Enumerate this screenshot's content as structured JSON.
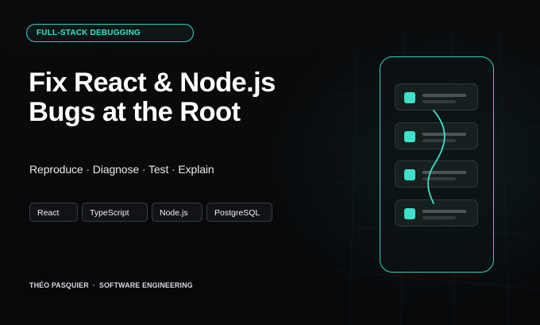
{
  "badge": {
    "label": "FULL-STACK DEBUGGING"
  },
  "headline": {
    "line1": "Fix React & Node.js",
    "line2": "Bugs at the Root"
  },
  "tagline": "Reproduce · Diagnose · Test · Explain",
  "tech_chips": [
    {
      "label": "React"
    },
    {
      "label": "TypeScript"
    },
    {
      "label": "Node.js"
    },
    {
      "label": "PostgreSQL"
    }
  ],
  "byline": {
    "author": "THÉO PASQUIER",
    "separator": "·",
    "role": "SOFTWARE ENGINEERING"
  },
  "illustration": {
    "icon": "phone-list-connector-icon",
    "card_count": 4
  },
  "colors": {
    "accent": "#2fd4c0",
    "background": "#08090b",
    "text": "#ffffff",
    "chip_border": "#3a3d42"
  }
}
